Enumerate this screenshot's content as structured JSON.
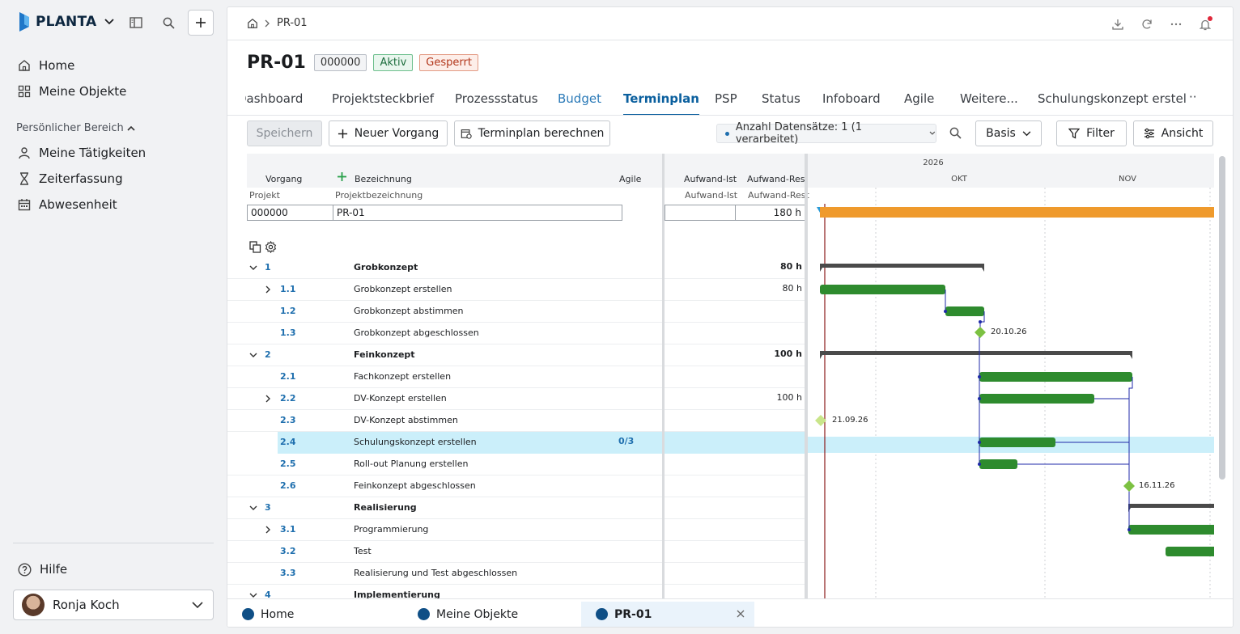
{
  "brand": {
    "name": "PLANTA"
  },
  "sidebar": {
    "nav": [
      {
        "label": "Home",
        "icon": "home-icon"
      },
      {
        "label": "Meine Objekte",
        "icon": "grid-icon"
      }
    ],
    "section_label": "Persönlicher Bereich",
    "personal": [
      {
        "label": "Meine Tätigkeiten",
        "icon": "person-icon"
      },
      {
        "label": "Zeiterfassung",
        "icon": "hourglass-icon"
      },
      {
        "label": "Abwesenheit",
        "icon": "calendar-icon"
      }
    ],
    "help_label": "Hilfe",
    "user_name": "Ronja Koch"
  },
  "breadcrumb": {
    "current": "PR-01"
  },
  "header": {
    "title": "PR-01",
    "badge_id": "000000",
    "badge_active": "Aktiv",
    "badge_locked": "Gesperrt"
  },
  "tabs": [
    "Dashboard",
    "Projektsteckbrief",
    "Prozessstatus",
    "Budget",
    "Terminplan",
    "PSP",
    "Status",
    "Infoboard",
    "Agile",
    "Weitere...",
    "Schulungskonzept erstel"
  ],
  "active_tab": "Terminplan",
  "toolbar": {
    "save": "Speichern",
    "new_task": "Neuer Vorgang",
    "calc": "Terminplan berechnen",
    "records": "Anzahl Datensätze: 1 (1 verarbeitet)",
    "basis": "Basis",
    "filter": "Filter",
    "view": "Ansicht"
  },
  "grid": {
    "headers": {
      "vorgang": "Vorgang",
      "bezeichnung": "Bezeichnung",
      "agile": "Agile",
      "aufwand_ist": "Aufwand-Ist",
      "aufwand_rest": "Aufwand-Rest"
    },
    "subheaders": {
      "projekt": "Projekt",
      "projektbezeichnung": "Projektbezeichnung",
      "aufwand_ist": "Aufwand-Ist",
      "aufwand_rest": "Aufwand-Rest"
    },
    "project_row": {
      "projekt": "000000",
      "bezeichnung": "PR-01",
      "aufwand_ist": "",
      "aufwand_rest": "180 h"
    },
    "rows": [
      {
        "num": "1",
        "name": "Grobkonzept",
        "hours": "80 h",
        "group": true,
        "expander": "down"
      },
      {
        "num": "1.1",
        "name": "Grobkonzept erstellen",
        "hours": "80 h",
        "group": false,
        "expander": "right"
      },
      {
        "num": "1.2",
        "name": "Grobkonzept abstimmen",
        "hours": "",
        "group": false,
        "expander": ""
      },
      {
        "num": "1.3",
        "name": "Grobkonzept abgeschlossen",
        "hours": "",
        "group": false,
        "expander": ""
      },
      {
        "num": "2",
        "name": "Feinkonzept",
        "hours": "100 h",
        "group": true,
        "expander": "down"
      },
      {
        "num": "2.1",
        "name": "Fachkonzept erstellen",
        "hours": "",
        "group": false,
        "expander": ""
      },
      {
        "num": "2.2",
        "name": "DV-Konzept erstellen",
        "hours": "100 h",
        "group": false,
        "expander": "right"
      },
      {
        "num": "2.3",
        "name": "DV-Konzept abstimmen",
        "hours": "",
        "group": false,
        "expander": ""
      },
      {
        "num": "2.4",
        "name": "Schulungskonzept erstellen",
        "hours": "",
        "group": false,
        "expander": "",
        "agile": "0/3",
        "selected": true
      },
      {
        "num": "2.5",
        "name": "Roll-out Planung erstellen",
        "hours": "",
        "group": false,
        "expander": ""
      },
      {
        "num": "2.6",
        "name": "Feinkonzept abgeschlossen",
        "hours": "",
        "group": false,
        "expander": ""
      },
      {
        "num": "3",
        "name": "Realisierung",
        "hours": "",
        "group": true,
        "expander": "down"
      },
      {
        "num": "3.1",
        "name": "Programmierung",
        "hours": "",
        "group": false,
        "expander": "right"
      },
      {
        "num": "3.2",
        "name": "Test",
        "hours": "",
        "group": false,
        "expander": ""
      },
      {
        "num": "3.3",
        "name": "Realisierung und Test abgeschlossen",
        "hours": "",
        "group": false,
        "expander": ""
      },
      {
        "num": "4",
        "name": "Implementierung",
        "hours": "",
        "group": true,
        "expander": "down"
      }
    ]
  },
  "gantt": {
    "year": "2026",
    "months": [
      "OKT",
      "NOV"
    ],
    "milestones": [
      "20.10.26",
      "21.09.26",
      "16.11.26"
    ],
    "colors": {
      "project_bar": "#ef9a2c",
      "task_bar": "#2e8b2e",
      "summary_bar": "#4a4a4a",
      "milestone": "#7cc142",
      "milestone_light": "#c9e58a",
      "today_line": "#8b1a1a",
      "link": "#1f2aa8"
    }
  },
  "bottom_tabs": [
    {
      "label": "Home",
      "active": false
    },
    {
      "label": "Meine Objekte",
      "active": false
    },
    {
      "label": "PR-01",
      "active": true
    }
  ]
}
